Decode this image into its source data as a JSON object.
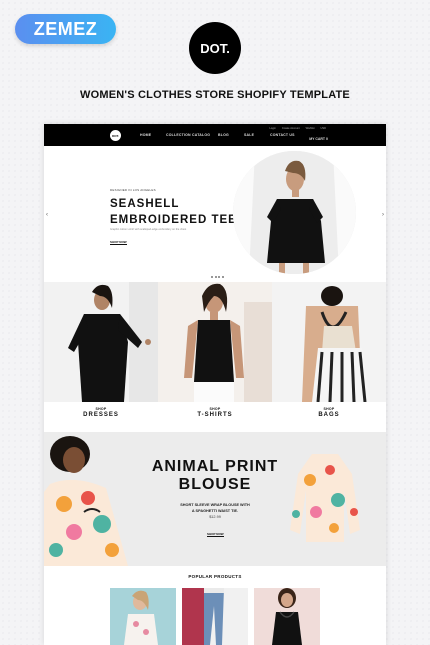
{
  "header": {
    "brand_badge": "ZEMEZ",
    "logo_text": "DOT.",
    "title": "WOMEN'S CLOTHES STORE SHOPIFY TEMPLATE"
  },
  "nav": {
    "logo_text": "DOT.",
    "items": [
      "HOME",
      "COLLECTION",
      "CATALOG",
      "BLOG",
      "SALE",
      "CONTACT US"
    ],
    "top_links": [
      "Login",
      "Create Account",
      "Wishlist",
      "USD"
    ],
    "cart_label": "MY CART 0"
  },
  "hero": {
    "kicker": "DESIGNED IN LOS ANGELES",
    "title_line1": "SEASHELL",
    "title_line2": "EMBROIDERED TEE",
    "description": "Graphic cotton t-shirt with scalloped-edge embroidery on the chest",
    "button": "SHOP NOW"
  },
  "categories": [
    {
      "small": "SHOP",
      "big": "DRESSES"
    },
    {
      "small": "SHOP",
      "big": "T-SHIRTS"
    },
    {
      "small": "SHOP",
      "big": "BAGS"
    }
  ],
  "banner": {
    "title_line1": "ANIMAL PRINT",
    "title_line2": "BLOUSE",
    "desc_line1": "SHORT SLEEVE WRAP BLOUSE WITH",
    "desc_line2": "A SPAGHETTI WAIST TIE.",
    "price": "$12.99",
    "button": "SHOP NOW"
  },
  "popular": {
    "title": "POPULAR PRODUCTS"
  },
  "colors": {
    "badge_start": "#5b8ff0",
    "badge_end": "#3ab4f3",
    "nav_bg": "#000000",
    "banner_bg": "#ececec"
  }
}
